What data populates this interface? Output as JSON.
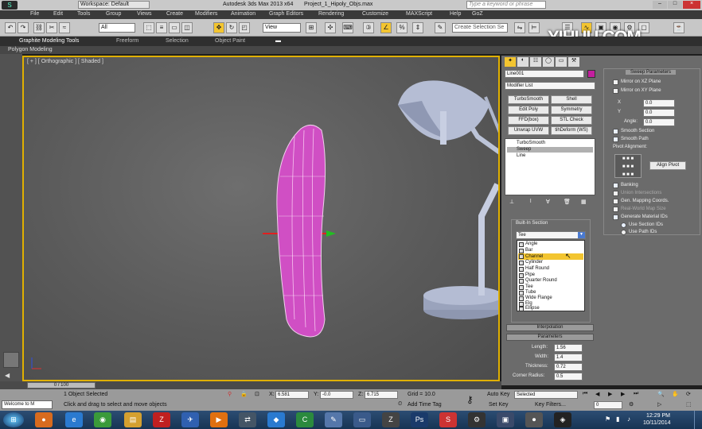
{
  "window": {
    "title": "Autodesk 3ds Max 2013 x64",
    "project": "Project_1_Hipoly_Objs.max",
    "workspace": "Workspace: Default",
    "search_placeholder": "Type a keyword or phrase"
  },
  "watermark": "YIHUU.COM",
  "menu": [
    "File",
    "Edit",
    "Tools",
    "Group",
    "Views",
    "Create",
    "Modifiers",
    "Animation",
    "Graph Editors",
    "Rendering",
    "Customize",
    "MAXScript",
    "Help",
    "GoZ"
  ],
  "toolbar": {
    "filter_value": "All",
    "view_value": "View",
    "selection_set": "Create Selection Se"
  },
  "ribbon": {
    "tabs": [
      "Graphite Modeling Tools",
      "Freeform",
      "Selection",
      "Object Paint"
    ],
    "sub": "Polygon Modeling"
  },
  "viewport": {
    "label": "[ + ] [ Orthographic ] [ Shaded ]"
  },
  "command_panel": {
    "object_name": "Line001",
    "modifier_list": "Modifier List",
    "mod_buttons": [
      "TurboSmooth",
      "Shell",
      "Edit Poly",
      "Symmetry",
      "FFD(box)",
      "STL Check",
      "Unwrap UVW",
      "XForm"
    ],
    "mod_buttons_extra": [
      "TurboSmooth",
      "Shell",
      "Edit Poly",
      "Symmetry",
      "FFD(box)",
      "STL Check",
      "Unwrap UVW",
      "tihDeform (WS)"
    ],
    "stack": [
      "TurboSmooth",
      "Sweep",
      "Line"
    ],
    "builtin_section_label": "Built-In Section",
    "builtin_selected": "Tee",
    "dropdown_items": [
      "Angle",
      "Bar",
      "Channel",
      "Cylinder",
      "Half Round",
      "Pipe",
      "Quarter Round",
      "Tee",
      "Tube",
      "Wide Flange",
      "Elg",
      "Ellipse"
    ],
    "dropdown_highlight": "Channel",
    "interpolation": "Interpolation",
    "parameters": "Parameters",
    "params": [
      {
        "label": "Length:",
        "value": "1.56"
      },
      {
        "label": "Width:",
        "value": "1.4"
      },
      {
        "label": "Thickness:",
        "value": "0.72"
      },
      {
        "label": "Corner Radius:",
        "value": "0.5"
      }
    ]
  },
  "sweep": {
    "header": "Sweep Parameters",
    "mirror_xz": "Mirror on XZ Plane",
    "mirror_xy": "Mirror on XY Plane",
    "x_label": "X",
    "x_value": "0.0",
    "y_label": "Y",
    "y_value": "0.0",
    "angle_label": "Angle:",
    "angle_value": "0.0",
    "smooth_section": "Smooth Section",
    "smooth_path": "Smooth Path",
    "pivot_alignment": "Pivot Alignment:",
    "align_pivot": "Align Pivot",
    "banking": "Banking",
    "union": "Union Intersections",
    "gen_mapping": "Gen. Mapping Coords.",
    "real_world": "Real-World Map Size",
    "gen_material": "Generate Material IDs",
    "use_section": "Use Section IDs",
    "use_path": "Use Path IDs"
  },
  "timeline": {
    "frame": "0 / 100"
  },
  "status": {
    "selected": "1 Object Selected",
    "prompt": "Click and drag to select and move objects",
    "x_label": "X:",
    "x": "6.581",
    "y_label": "Y:",
    "y": "-0.0",
    "z_label": "Z:",
    "z": "6.715",
    "grid": "Grid = 10.0",
    "add_time_tag": "Add Time Tag",
    "auto_key": "Auto Key",
    "set_key": "Set Key",
    "selected_dd": "Selected",
    "key_filters": "Key Filters...",
    "frame_field": "0",
    "welcome": "Welcome to M"
  },
  "taskbar": {
    "time": "12:29 PM",
    "date": "10/11/2014"
  },
  "colors": {
    "accent": "#e0b000",
    "object": "#d04fc4",
    "color_swatch": "#c41f9f"
  }
}
